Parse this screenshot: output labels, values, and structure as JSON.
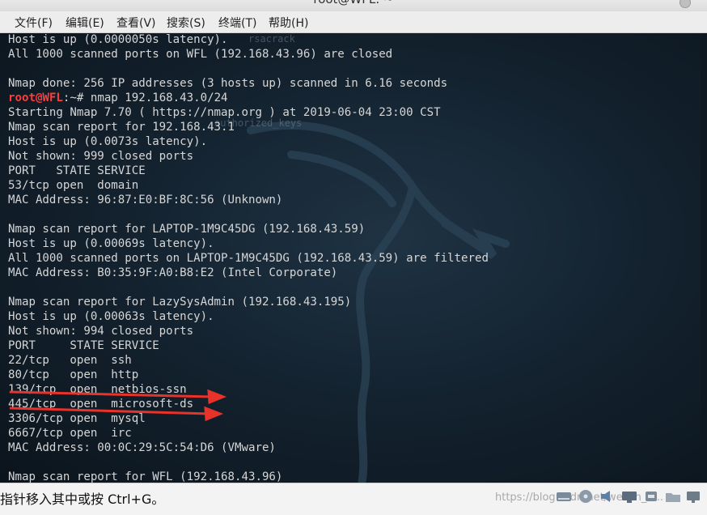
{
  "window": {
    "title": "root@WFL: ~"
  },
  "menu": [
    "文件(F)",
    "编辑(E)",
    "查看(V)",
    "搜索(S)",
    "终端(T)",
    "帮助(H)"
  ],
  "terminal": {
    "prompt_user": "root@WFL",
    "prompt_path": ":~# ",
    "command": "nmap 192.168.43.0/24",
    "lines": [
      "Host is up (0.0000050s latency).",
      "All 1000 scanned ports on WFL (192.168.43.96) are closed",
      "",
      "Nmap done: 256 IP addresses (3 hosts up) scanned in 6.16 seconds",
      "__PROMPT__",
      "Starting Nmap 7.70 ( https://nmap.org ) at 2019-06-04 23:00 CST",
      "Nmap scan report for 192.168.43.1",
      "Host is up (0.0073s latency).",
      "Not shown: 999 closed ports",
      "PORT   STATE SERVICE",
      "53/tcp open  domain",
      "MAC Address: 96:87:E0:BF:8C:56 (Unknown)",
      "",
      "Nmap scan report for LAPTOP-1M9C45DG (192.168.43.59)",
      "Host is up (0.00069s latency).",
      "All 1000 scanned ports on LAPTOP-1M9C45DG (192.168.43.59) are filtered",
      "MAC Address: B0:35:9F:A0:B8:E2 (Intel Corporate)",
      "",
      "Nmap scan report for LazySysAdmin (192.168.43.195)",
      "Host is up (0.00063s latency).",
      "Not shown: 994 closed ports",
      "PORT     STATE SERVICE",
      "22/tcp   open  ssh",
      "80/tcp   open  http",
      "139/tcp  open  netbios-ssn",
      "445/tcp  open  microsoft-ds",
      "3306/tcp open  mysql",
      "6667/tcp open  irc",
      "MAC Address: 00:0C:29:5C:54:D6 (VMware)",
      "",
      "Nmap scan report for WFL (192.168.43.96)"
    ],
    "ghost_texts": [
      "rsacrack",
      "authorized_keys"
    ]
  },
  "status": {
    "hint": "指针移入其中或按 Ctrl+G。",
    "watermark": "https://blog.csdn.net/weixin_4..."
  },
  "colors": {
    "prompt_user": "#ff3b3b",
    "terminal_text": "#d6d6d6",
    "annotation_arrow": "#e8322a"
  }
}
